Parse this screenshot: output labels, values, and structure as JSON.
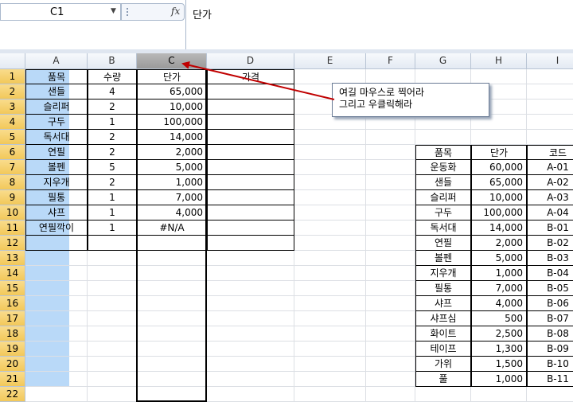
{
  "name_box": {
    "value": "C1"
  },
  "fx_label": "fx",
  "formula_bar": {
    "value": "단가"
  },
  "columns": [
    "A",
    "B",
    "C",
    "D",
    "E",
    "F",
    "G",
    "H",
    "I"
  ],
  "selected_column": "C",
  "rows": [
    "1",
    "2",
    "3",
    "4",
    "5",
    "6",
    "7",
    "8",
    "9",
    "10",
    "11",
    "12",
    "13",
    "14",
    "15",
    "16",
    "17",
    "18",
    "19",
    "20",
    "21",
    "22"
  ],
  "table1": {
    "headers": [
      "품목",
      "수량",
      "단가",
      "가격"
    ],
    "rows": [
      [
        "샌들",
        "4",
        "65,000",
        ""
      ],
      [
        "슬리퍼",
        "2",
        "10,000",
        ""
      ],
      [
        "구두",
        "1",
        "100,000",
        ""
      ],
      [
        "독서대",
        "2",
        "14,000",
        ""
      ],
      [
        "연필",
        "2",
        "2,000",
        ""
      ],
      [
        "볼펜",
        "5",
        "5,000",
        ""
      ],
      [
        "지우개",
        "2",
        "1,000",
        ""
      ],
      [
        "필통",
        "1",
        "7,000",
        ""
      ],
      [
        "샤프",
        "1",
        "4,000",
        ""
      ],
      [
        "연필깍이",
        "1",
        "#N/A",
        ""
      ]
    ]
  },
  "table2": {
    "headers": [
      "품목",
      "단가",
      "코드"
    ],
    "rows": [
      [
        "운동화",
        "60,000",
        "A-01"
      ],
      [
        "샌들",
        "65,000",
        "A-02"
      ],
      [
        "슬리퍼",
        "10,000",
        "A-03"
      ],
      [
        "구두",
        "100,000",
        "A-04"
      ],
      [
        "독서대",
        "14,000",
        "B-01"
      ],
      [
        "연필",
        "2,000",
        "B-02"
      ],
      [
        "볼펜",
        "5,000",
        "B-03"
      ],
      [
        "지우개",
        "1,000",
        "B-04"
      ],
      [
        "필통",
        "7,000",
        "B-05"
      ],
      [
        "샤프",
        "4,000",
        "B-06"
      ],
      [
        "샤프심",
        "500",
        "B-07"
      ],
      [
        "화이트",
        "2,500",
        "B-08"
      ],
      [
        "테이프",
        "1,300",
        "B-09"
      ],
      [
        "가위",
        "1,500",
        "B-10"
      ],
      [
        "풀",
        "1,000",
        "B-11"
      ]
    ]
  },
  "callout": {
    "line1": "여길 마우스로 찍어라",
    "line2": "그리고 우클릭해라"
  },
  "colors": {
    "selection": "#b9d9f8",
    "arrow": "#c00000",
    "header_selected": "#f2c85a"
  }
}
